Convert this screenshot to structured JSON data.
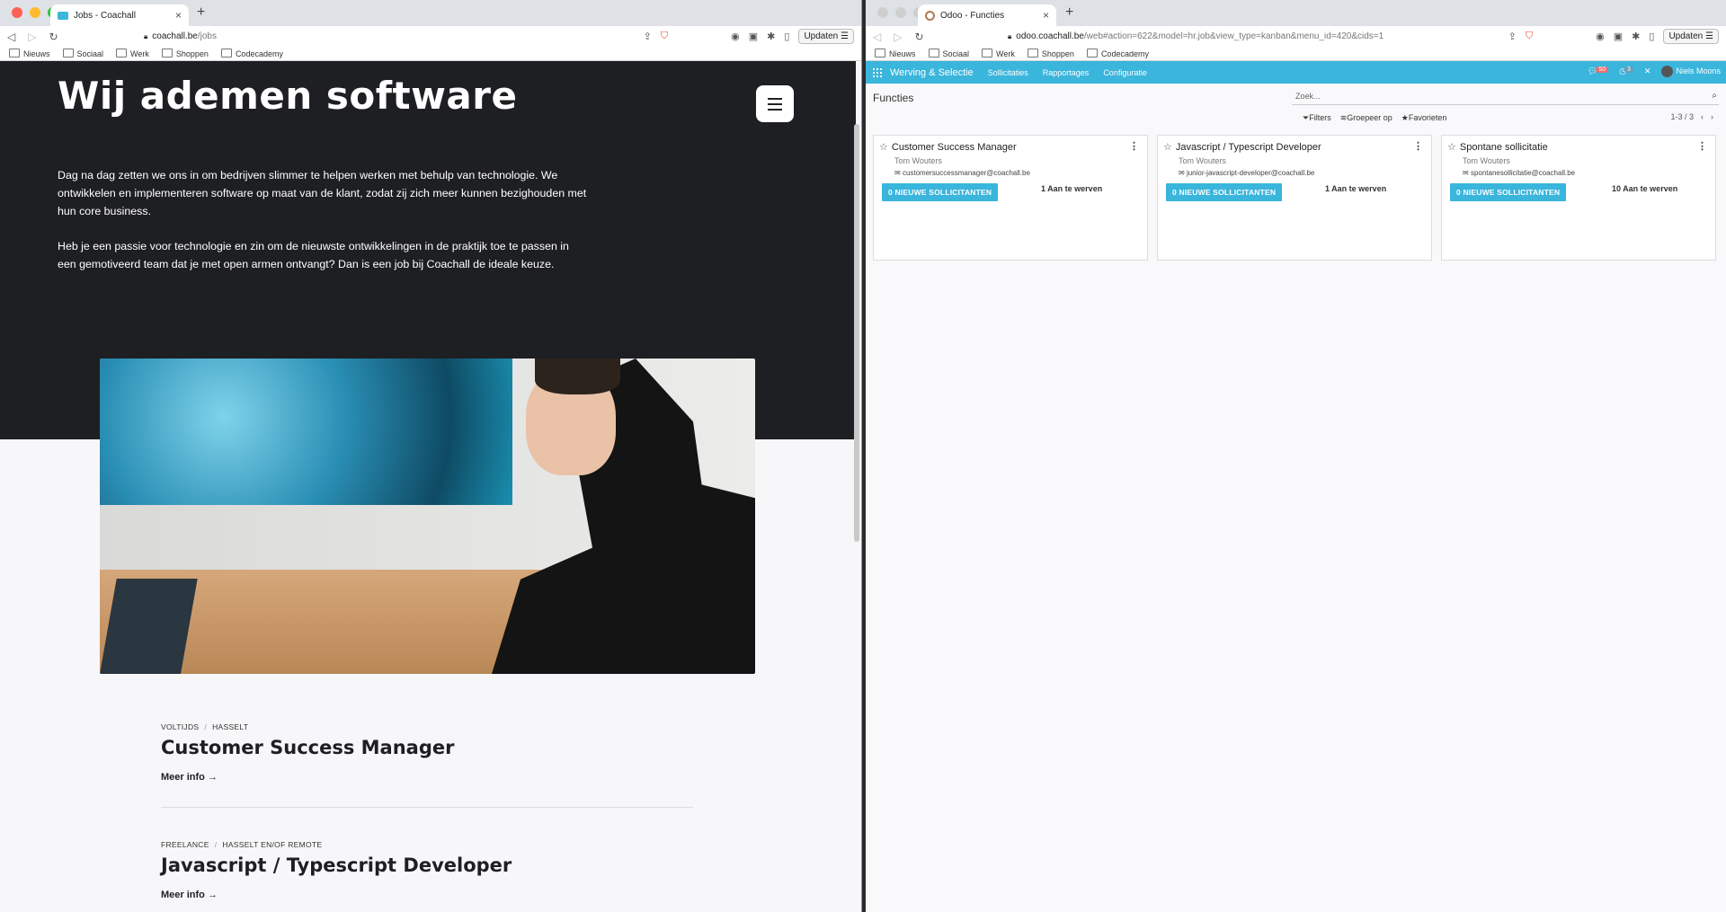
{
  "left_window": {
    "tab_title": "Jobs - Coachall",
    "url_host": "coachall.be",
    "url_path": "/jobs",
    "update_label": "Updaten",
    "bookmarks": [
      "Nieuws",
      "Sociaal",
      "Werk",
      "Shoppen",
      "Codecademy"
    ],
    "hero": {
      "title": "Wij ademen software",
      "paragraph1": "Dag na dag zetten we ons in om bedrijven slimmer te helpen werken met behulp van technologie. We ontwikkelen en implementeren software op maat van de klant, zodat zij zich meer kunnen bezighouden met hun core business.",
      "paragraph2": "Heb je een passie voor technologie en zin om de nieuwste ontwikkelingen in de praktijk toe te passen in een gemotiveerd team dat je met open armen ontvangt? Dan is een job bij Coachall de ideale keuze."
    },
    "jobs": [
      {
        "type": "VOLTIJDS",
        "location": "HASSELT",
        "title": "Customer Success Manager",
        "more": "Meer info →"
      },
      {
        "type": "FREELANCE",
        "location": "HASSELT EN/OF REMOTE",
        "title": "Javascript / Typescript Developer",
        "more": "Meer info →"
      }
    ]
  },
  "right_window": {
    "tab_title": "Odoo - Functies",
    "url_host": "odoo.coachall.be",
    "url_path": "/web#action=622&model=hr.job&view_type=kanban&menu_id=420&cids=1",
    "update_label": "Updaten",
    "bookmarks": [
      "Nieuws",
      "Sociaal",
      "Werk",
      "Shoppen",
      "Codecademy"
    ],
    "app_name": "Werving & Selectie",
    "menu": [
      "Sollicitaties",
      "Rapportages",
      "Configuratie"
    ],
    "messages_count": "50",
    "activities_count": "3",
    "user_name": "Niels Moons",
    "breadcrumb": "Functies",
    "search_placeholder": "Zoek...",
    "filters_label": "Filters",
    "groupby_label": "Groepeer op",
    "favorites_label": "Favorieten",
    "pager": "1-3 / 3",
    "cards": [
      {
        "title": "Customer Success Manager",
        "owner": "Tom Wouters",
        "email": "customersuccessmanager@coachall.be",
        "button": "0 NIEUWE SOLLICITANTEN",
        "to_recruit": "1 Aan te werven"
      },
      {
        "title": "Javascript / Typescript Developer",
        "owner": "Tom Wouters",
        "email": "junior-javascript-developer@coachall.be",
        "button": "0 NIEUWE SOLLICITANTEN",
        "to_recruit": "1 Aan te werven"
      },
      {
        "title": "Spontane sollicitatie",
        "owner": "Tom Wouters",
        "email": "spontanesollicitatie@coachall.be",
        "button": "0 NIEUWE SOLLICITANTEN",
        "to_recruit": "10 Aan te werven"
      }
    ]
  }
}
